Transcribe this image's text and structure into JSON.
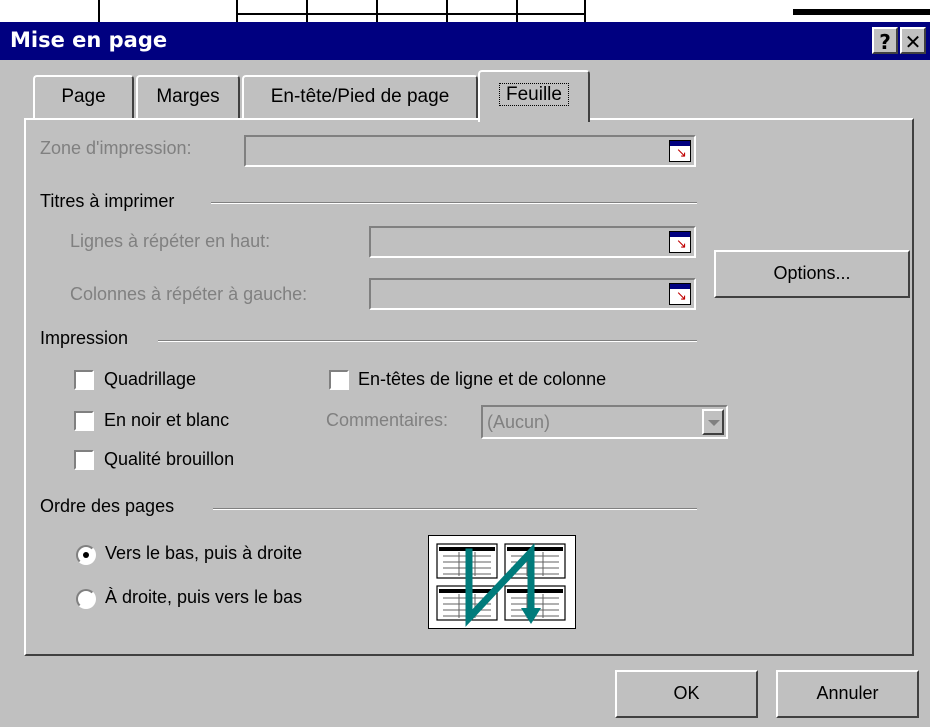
{
  "dialog": {
    "title": "Mise en page",
    "help_glyph": "?",
    "close_glyph": "✕"
  },
  "tabs": [
    {
      "label": "Page"
    },
    {
      "label": "Marges"
    },
    {
      "label": "En-tête/Pied de page"
    },
    {
      "label": "Feuille",
      "active": true
    }
  ],
  "print_area": {
    "label": "Zone d'impression:",
    "value": ""
  },
  "print_titles": {
    "heading": "Titres à imprimer",
    "rows_label": "Lignes à répéter en haut:",
    "rows_value": "",
    "cols_label": "Colonnes à répéter à gauche:",
    "cols_value": ""
  },
  "options_button": {
    "label": "Options..."
  },
  "printing": {
    "heading": "Impression",
    "gridlines": {
      "label": "Quadrillage",
      "checked": false
    },
    "black_white": {
      "label": "En noir et blanc",
      "checked": false
    },
    "draft": {
      "label": "Qualité brouillon",
      "checked": false
    },
    "headings": {
      "label": "En-têtes de ligne et de colonne",
      "checked": false
    },
    "comments_label": "Commentaires:",
    "comments_value": "(Aucun)"
  },
  "page_order": {
    "heading": "Ordre des pages",
    "down_then_over": {
      "label": "Vers le bas, puis à droite",
      "selected": true
    },
    "over_then_down": {
      "label": "À droite, puis vers le bas",
      "selected": false
    }
  },
  "footer": {
    "ok_label": "OK",
    "cancel_label": "Annuler"
  },
  "colors": {
    "title_bar": "#000080",
    "face": "#c0c0c0",
    "arrow": "#007b7b"
  }
}
